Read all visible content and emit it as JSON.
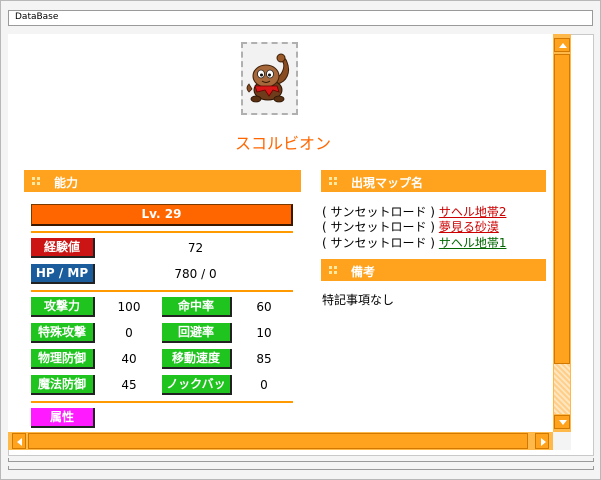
{
  "window": {
    "title": "DataBase"
  },
  "monster": {
    "name": "スコルビオン"
  },
  "sections": {
    "stats": "能力",
    "maps": "出現マップ名",
    "notes": "備考"
  },
  "level": "Lv. 29",
  "exp": {
    "label": "経験値",
    "value": "72"
  },
  "hpmp": {
    "label": "HP / MP",
    "value": "780 / 0"
  },
  "stats": [
    {
      "label": "攻撃力",
      "value": "100"
    },
    {
      "label": "命中率",
      "value": "60"
    },
    {
      "label": "特殊攻撃",
      "value": "0"
    },
    {
      "label": "回避率",
      "value": "10"
    },
    {
      "label": "物理防御",
      "value": "40"
    },
    {
      "label": "移動速度",
      "value": "85"
    },
    {
      "label": "魔法防御",
      "value": "45"
    },
    {
      "label": "ノックバック",
      "value": "0"
    }
  ],
  "attribute": {
    "label": "属性"
  },
  "maps": [
    {
      "region": "( サンセットロード )",
      "map": "サヘル地帯2"
    },
    {
      "region": "( サンセットロード )",
      "map": "夢見る砂漠"
    },
    {
      "region": "( サンセットロード )",
      "map": "サヘル地帯1"
    }
  ],
  "notes": {
    "text": "特記事項なし"
  },
  "colors": {
    "accent": "#ffa31f",
    "level_bar": "#ff6600",
    "name": "#ff6600",
    "exp_tag": "#cc1414",
    "hpmp_tag": "#1a5c9c",
    "stat_tag": "#1fc41f",
    "attr_tag": "#ff1aff",
    "link_red": "#cc0000",
    "link_green": "#006600"
  },
  "icons": [
    "monster-portrait-icon",
    "section-bullet-icon",
    "scroll-up-icon",
    "scroll-down-icon",
    "scroll-left-icon",
    "scroll-right-icon"
  ]
}
